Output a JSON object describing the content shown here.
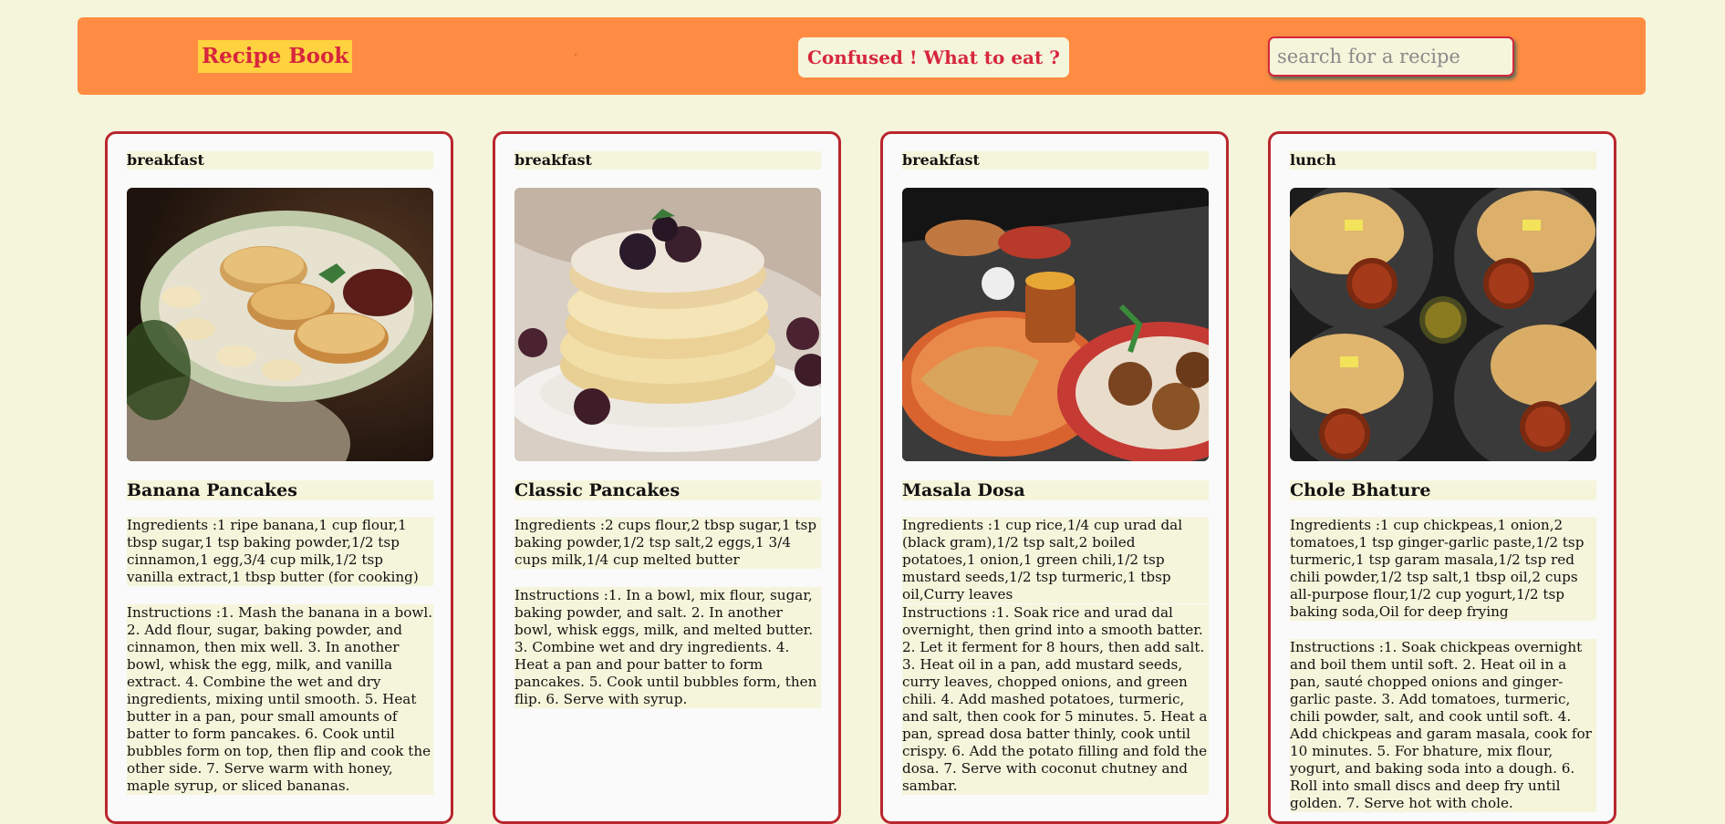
{
  "header": {
    "brand": "Recipe Book",
    "random_button": "Confused ! What to eat ?",
    "search_placeholder": "search for a recipe"
  },
  "recipes": [
    {
      "category": "breakfast",
      "name": "Banana Pancakes",
      "ingredients": "Ingredients :1 ripe banana,1 cup flour,1 tbsp sugar,1 tsp baking powder,1/2 tsp cinnamon,1 egg,3/4 cup milk,1/2 tsp vanilla extract,1 tbsp butter (for cooking)",
      "instructions": "Instructions :1. Mash the banana in a bowl. 2. Add flour, sugar, baking powder, and cinnamon, then mix well. 3. In another bowl, whisk the egg, milk, and vanilla extract. 4. Combine the wet and dry ingredients, mixing until smooth. 5. Heat butter in a pan, pour small amounts of batter to form pancakes. 6. Cook until bubbles form on top, then flip and cook the other side. 7. Serve warm with honey, maple syrup, or sliced bananas."
    },
    {
      "category": "breakfast",
      "name": "Classic Pancakes",
      "ingredients": "Ingredients :2 cups flour,2 tbsp sugar,1 tsp baking powder,1/2 tsp salt,2 eggs,1 3/4 cups milk,1/4 cup melted butter",
      "instructions": "Instructions :1. In a bowl, mix flour, sugar, baking powder, and salt. 2. In another bowl, whisk eggs, milk, and melted butter. 3. Combine wet and dry ingredients. 4. Heat a pan and pour batter to form pancakes. 5. Cook until bubbles form, then flip. 6. Serve with syrup."
    },
    {
      "category": "breakfast",
      "name": "Masala Dosa",
      "ingredients": "Ingredients :1 cup rice,1/4 cup urad dal (black gram),1/2 tsp salt,2 boiled potatoes,1 onion,1 green chili,1/2 tsp mustard seeds,1/2 tsp turmeric,1 tbsp oil,Curry leaves",
      "instructions": "Instructions :1. Soak rice and urad dal overnight, then grind into a smooth batter. 2. Let it ferment for 8 hours, then add salt. 3. Heat oil in a pan, add mustard seeds, curry leaves, chopped onions, and green chili. 4. Add mashed potatoes, turmeric, and salt, then cook for 5 minutes. 5. Heat a pan, spread dosa batter thinly, cook until crispy. 6. Add the potato filling and fold the dosa. 7. Serve with coconut chutney and sambar."
    },
    {
      "category": "lunch",
      "name": "Chole Bhature",
      "ingredients": "Ingredients :1 cup chickpeas,1 onion,2 tomatoes,1 tsp ginger-garlic paste,1/2 tsp turmeric,1 tsp garam masala,1/2 tsp red chili powder,1/2 tsp salt,1 tbsp oil,2 cups all-purpose flour,1/2 cup yogurt,1/2 tsp baking soda,Oil for deep frying",
      "instructions": "Instructions :1. Soak chickpeas overnight and boil them until soft. 2. Heat oil in a pan, sauté chopped onions and ginger-garlic paste. 3. Add tomatoes, turmeric, chili powder, salt, and cook until soft. 4. Add chickpeas and garam masala, cook for 10 minutes. 5. For bhature, mix flour, yogurt, and baking soda into a dough. 6. Roll into small discs and deep fry until golden. 7. Serve hot with chole."
    }
  ]
}
